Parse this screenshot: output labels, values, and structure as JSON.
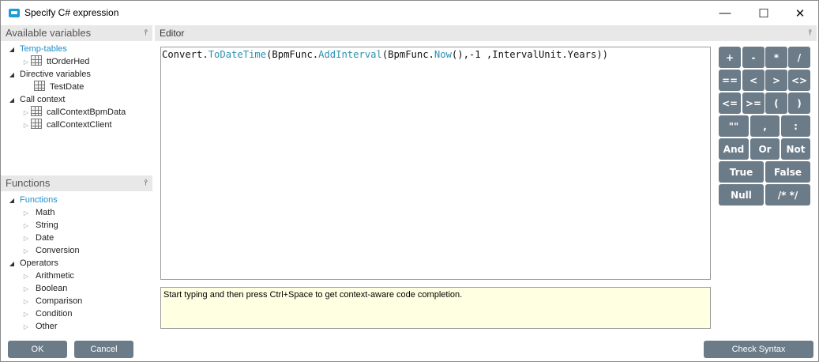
{
  "window": {
    "title": "Specify C# expression",
    "minimize": "—",
    "maximize": "☐",
    "close": "✕"
  },
  "variables_panel": {
    "header": "Available variables",
    "pin": "📌",
    "items": [
      {
        "label": "Temp-tables",
        "expander": "◢",
        "accent": true
      },
      {
        "label": "ttOrderHed",
        "expander": "▷",
        "icon": "table-icon"
      },
      {
        "label": "Directive variables",
        "expander": "◢"
      },
      {
        "label": "TestDate",
        "expander": "",
        "icon": "table-icon"
      },
      {
        "label": "Call context",
        "expander": "◢"
      },
      {
        "label": "callContextBpmData",
        "expander": "▷",
        "icon": "table-icon"
      },
      {
        "label": "callContextClient",
        "expander": "▷",
        "icon": "table-icon"
      }
    ]
  },
  "functions_panel": {
    "header": "Functions",
    "pin": "📌",
    "items": [
      {
        "label": "Functions",
        "expander": "◢",
        "accent": true
      },
      {
        "label": "Math",
        "expander": "▷"
      },
      {
        "label": "String",
        "expander": "▷"
      },
      {
        "label": "Date",
        "expander": "▷"
      },
      {
        "label": "Conversion",
        "expander": "▷"
      },
      {
        "label": "Operators",
        "expander": "◢"
      },
      {
        "label": "Arithmetic",
        "expander": "▷"
      },
      {
        "label": "Boolean",
        "expander": "▷"
      },
      {
        "label": "Comparison",
        "expander": "▷"
      },
      {
        "label": "Condition",
        "expander": "▷"
      },
      {
        "label": "Other",
        "expander": "▷"
      }
    ]
  },
  "editor": {
    "header": "Editor",
    "pin": "📌",
    "code": {
      "t1": "Convert.",
      "t2": "ToDateTime",
      "t3": "(BpmFunc.",
      "t4": "AddInterval",
      "t5": "(BpmFunc.",
      "t6": "Now",
      "t7": "(),-1 ,IntervalUnit.Years))"
    },
    "hint": "Start typing and then press Ctrl+Space to get context-aware code completion."
  },
  "calculator": {
    "plus": "+",
    "minus": "-",
    "multiply": "*",
    "divide": "/",
    "eq": "==",
    "lt": "<",
    "gt": ">",
    "neq": "<>",
    "le": "<=",
    "ge": ">=",
    "lparen": "(",
    "rparen": ")",
    "quotes": "\"\"",
    "comma": ",",
    "colon": ":",
    "and": "And",
    "or": "Or",
    "not": "Not",
    "true": "True",
    "false": "False",
    "null": "Null",
    "comment": "/* */"
  },
  "footer": {
    "ok": "OK",
    "cancel": "Cancel",
    "check_syntax": "Check Syntax"
  }
}
